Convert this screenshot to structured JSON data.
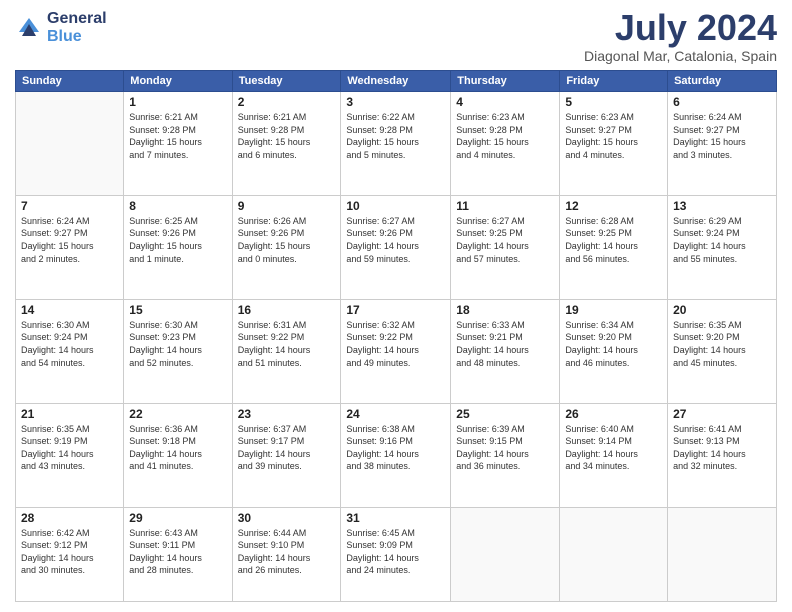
{
  "logo": {
    "general": "General",
    "blue": "Blue"
  },
  "header": {
    "month": "July 2024",
    "location": "Diagonal Mar, Catalonia, Spain"
  },
  "weekdays": [
    "Sunday",
    "Monday",
    "Tuesday",
    "Wednesday",
    "Thursday",
    "Friday",
    "Saturday"
  ],
  "weeks": [
    [
      {
        "day": "",
        "info": ""
      },
      {
        "day": "1",
        "info": "Sunrise: 6:21 AM\nSunset: 9:28 PM\nDaylight: 15 hours\nand 7 minutes."
      },
      {
        "day": "2",
        "info": "Sunrise: 6:21 AM\nSunset: 9:28 PM\nDaylight: 15 hours\nand 6 minutes."
      },
      {
        "day": "3",
        "info": "Sunrise: 6:22 AM\nSunset: 9:28 PM\nDaylight: 15 hours\nand 5 minutes."
      },
      {
        "day": "4",
        "info": "Sunrise: 6:23 AM\nSunset: 9:28 PM\nDaylight: 15 hours\nand 4 minutes."
      },
      {
        "day": "5",
        "info": "Sunrise: 6:23 AM\nSunset: 9:27 PM\nDaylight: 15 hours\nand 4 minutes."
      },
      {
        "day": "6",
        "info": "Sunrise: 6:24 AM\nSunset: 9:27 PM\nDaylight: 15 hours\nand 3 minutes."
      }
    ],
    [
      {
        "day": "7",
        "info": "Sunrise: 6:24 AM\nSunset: 9:27 PM\nDaylight: 15 hours\nand 2 minutes."
      },
      {
        "day": "8",
        "info": "Sunrise: 6:25 AM\nSunset: 9:26 PM\nDaylight: 15 hours\nand 1 minute."
      },
      {
        "day": "9",
        "info": "Sunrise: 6:26 AM\nSunset: 9:26 PM\nDaylight: 15 hours\nand 0 minutes."
      },
      {
        "day": "10",
        "info": "Sunrise: 6:27 AM\nSunset: 9:26 PM\nDaylight: 14 hours\nand 59 minutes."
      },
      {
        "day": "11",
        "info": "Sunrise: 6:27 AM\nSunset: 9:25 PM\nDaylight: 14 hours\nand 57 minutes."
      },
      {
        "day": "12",
        "info": "Sunrise: 6:28 AM\nSunset: 9:25 PM\nDaylight: 14 hours\nand 56 minutes."
      },
      {
        "day": "13",
        "info": "Sunrise: 6:29 AM\nSunset: 9:24 PM\nDaylight: 14 hours\nand 55 minutes."
      }
    ],
    [
      {
        "day": "14",
        "info": "Sunrise: 6:30 AM\nSunset: 9:24 PM\nDaylight: 14 hours\nand 54 minutes."
      },
      {
        "day": "15",
        "info": "Sunrise: 6:30 AM\nSunset: 9:23 PM\nDaylight: 14 hours\nand 52 minutes."
      },
      {
        "day": "16",
        "info": "Sunrise: 6:31 AM\nSunset: 9:22 PM\nDaylight: 14 hours\nand 51 minutes."
      },
      {
        "day": "17",
        "info": "Sunrise: 6:32 AM\nSunset: 9:22 PM\nDaylight: 14 hours\nand 49 minutes."
      },
      {
        "day": "18",
        "info": "Sunrise: 6:33 AM\nSunset: 9:21 PM\nDaylight: 14 hours\nand 48 minutes."
      },
      {
        "day": "19",
        "info": "Sunrise: 6:34 AM\nSunset: 9:20 PM\nDaylight: 14 hours\nand 46 minutes."
      },
      {
        "day": "20",
        "info": "Sunrise: 6:35 AM\nSunset: 9:20 PM\nDaylight: 14 hours\nand 45 minutes."
      }
    ],
    [
      {
        "day": "21",
        "info": "Sunrise: 6:35 AM\nSunset: 9:19 PM\nDaylight: 14 hours\nand 43 minutes."
      },
      {
        "day": "22",
        "info": "Sunrise: 6:36 AM\nSunset: 9:18 PM\nDaylight: 14 hours\nand 41 minutes."
      },
      {
        "day": "23",
        "info": "Sunrise: 6:37 AM\nSunset: 9:17 PM\nDaylight: 14 hours\nand 39 minutes."
      },
      {
        "day": "24",
        "info": "Sunrise: 6:38 AM\nSunset: 9:16 PM\nDaylight: 14 hours\nand 38 minutes."
      },
      {
        "day": "25",
        "info": "Sunrise: 6:39 AM\nSunset: 9:15 PM\nDaylight: 14 hours\nand 36 minutes."
      },
      {
        "day": "26",
        "info": "Sunrise: 6:40 AM\nSunset: 9:14 PM\nDaylight: 14 hours\nand 34 minutes."
      },
      {
        "day": "27",
        "info": "Sunrise: 6:41 AM\nSunset: 9:13 PM\nDaylight: 14 hours\nand 32 minutes."
      }
    ],
    [
      {
        "day": "28",
        "info": "Sunrise: 6:42 AM\nSunset: 9:12 PM\nDaylight: 14 hours\nand 30 minutes."
      },
      {
        "day": "29",
        "info": "Sunrise: 6:43 AM\nSunset: 9:11 PM\nDaylight: 14 hours\nand 28 minutes."
      },
      {
        "day": "30",
        "info": "Sunrise: 6:44 AM\nSunset: 9:10 PM\nDaylight: 14 hours\nand 26 minutes."
      },
      {
        "day": "31",
        "info": "Sunrise: 6:45 AM\nSunset: 9:09 PM\nDaylight: 14 hours\nand 24 minutes."
      },
      {
        "day": "",
        "info": ""
      },
      {
        "day": "",
        "info": ""
      },
      {
        "day": "",
        "info": ""
      }
    ]
  ]
}
